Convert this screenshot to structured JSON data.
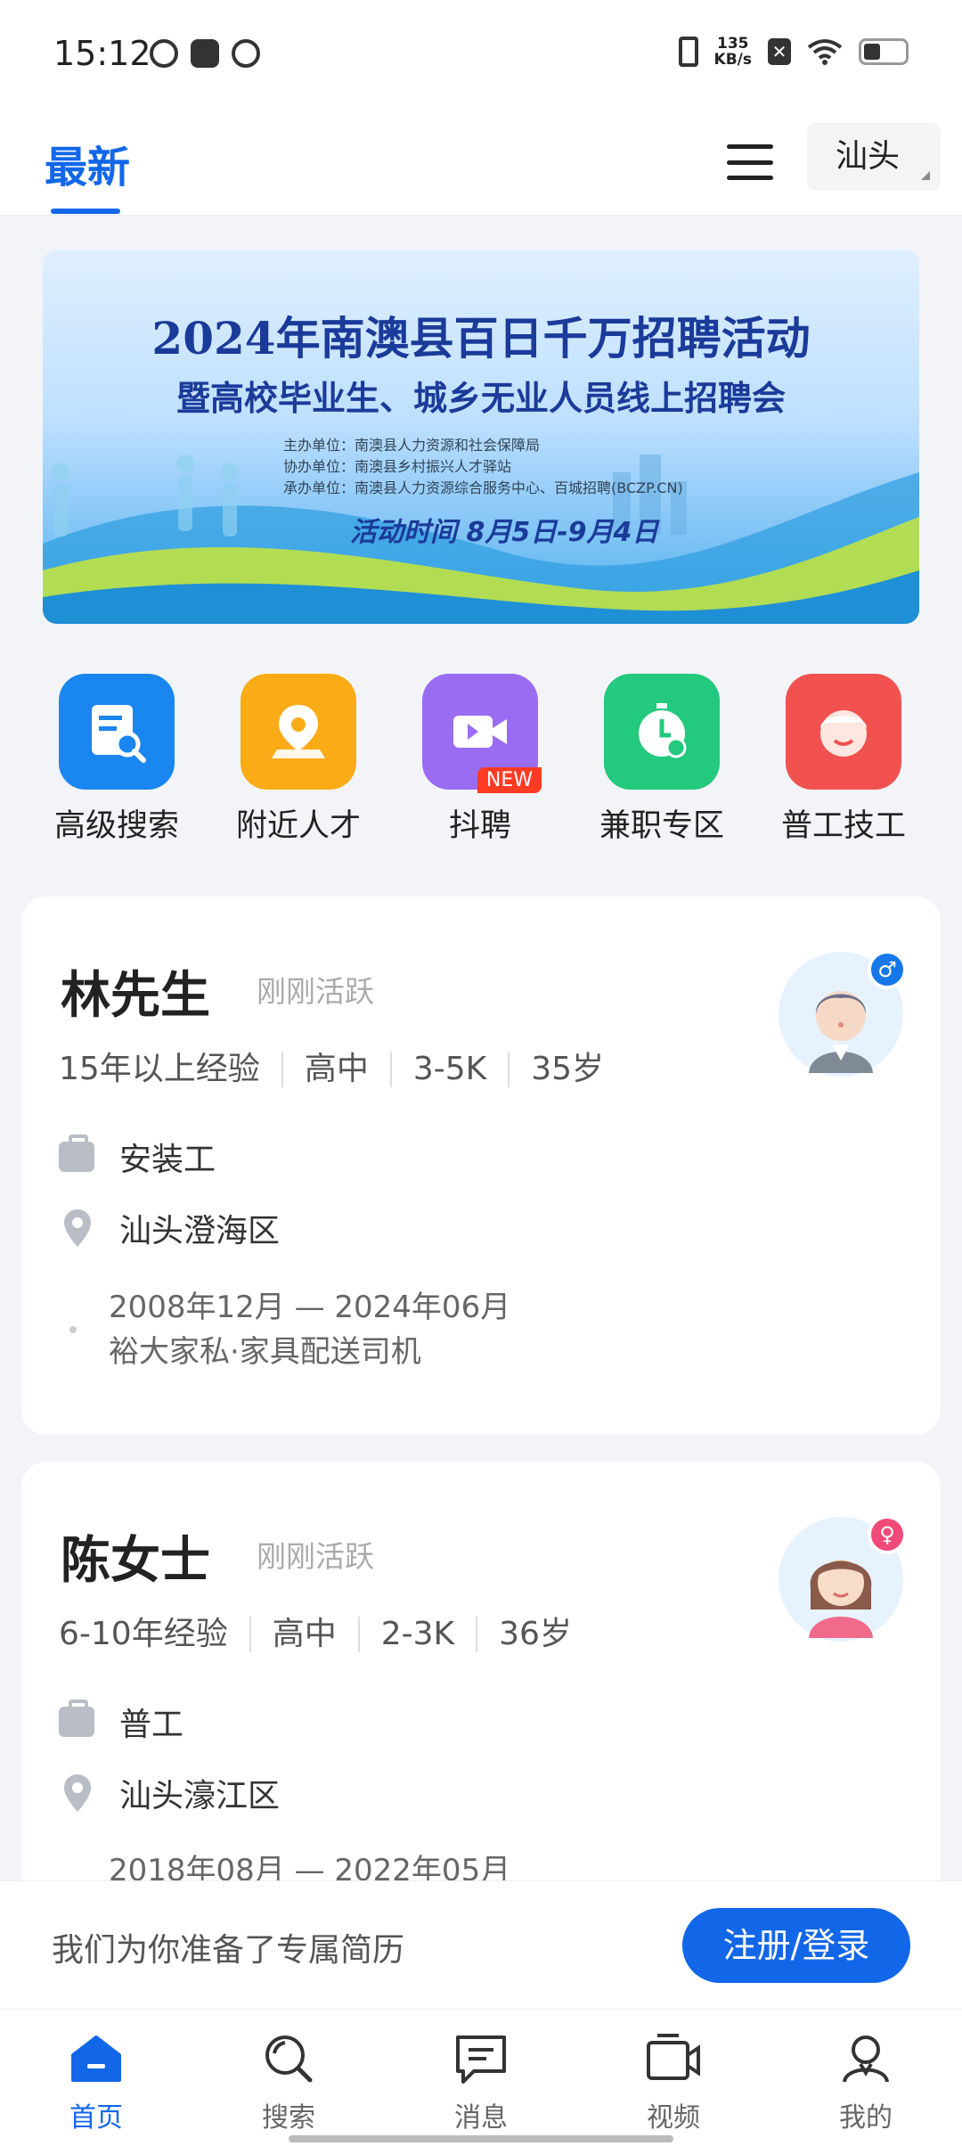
{
  "status_bar": {
    "time": "15:12",
    "net_speed_value": "135",
    "net_speed_unit": "KB/s"
  },
  "header": {
    "tab_latest": "最新",
    "city": "汕头"
  },
  "banner": {
    "title_line1": "2024年南澳县百日千万招聘活动",
    "title_line2": "暨高校毕业生、城乡无业人员线上招聘会",
    "org1": "主办单位：南澳县人力资源和社会保障局",
    "org2": "协办单位：南澳县乡村振兴人才驿站",
    "org3": "承办单位：南澳县人力资源综合服务中心、百城招聘(BCZP.CN)",
    "date": "活动时间 8月5日-9月4日"
  },
  "quick_nav": [
    {
      "label": "高级搜索",
      "icon": "document-search-icon",
      "color": "#1a86f0"
    },
    {
      "label": "附近人才",
      "icon": "location-pin-icon",
      "color": "#fbab16"
    },
    {
      "label": "抖聘",
      "icon": "video-camera-icon",
      "color": "#9a6cf2",
      "badge": "NEW"
    },
    {
      "label": "兼职专区",
      "icon": "stopwatch-icon",
      "color": "#23c97c"
    },
    {
      "label": "普工技工",
      "icon": "worker-face-icon",
      "color": "#f1514f"
    }
  ],
  "candidates": [
    {
      "name": "林先生",
      "active": "刚刚活跃",
      "tags": [
        "15年以上经验",
        "高中",
        "3-5K",
        "35岁"
      ],
      "job": "安装工",
      "location": "汕头澄海区",
      "work_period": "2008年12月 — 2024年06月",
      "work_desc": "裕大家私·家具配送司机",
      "gender": "male",
      "gender_symbol": "♂"
    },
    {
      "name": "陈女士",
      "active": "刚刚活跃",
      "tags": [
        "6-10年经验",
        "高中",
        "2-3K",
        "36岁"
      ],
      "job": "普工",
      "location": "汕头濠江区",
      "work_period": "2018年08月 — 2022年05月",
      "gender": "female",
      "gender_symbol": "♀"
    }
  ],
  "prompt_bar": {
    "text": "我们为你准备了专属简历",
    "button": "注册/登录"
  },
  "tab_bar": [
    {
      "label": "首页",
      "icon": "home-icon",
      "active": true
    },
    {
      "label": "搜索",
      "icon": "search-icon",
      "active": false
    },
    {
      "label": "消息",
      "icon": "message-icon",
      "active": false
    },
    {
      "label": "视频",
      "icon": "video-icon",
      "active": false
    },
    {
      "label": "我的",
      "icon": "profile-icon",
      "active": false
    }
  ],
  "colors": {
    "accent": "#1267e8",
    "male_badge": "#1677e8",
    "female_badge": "#f04a78"
  }
}
